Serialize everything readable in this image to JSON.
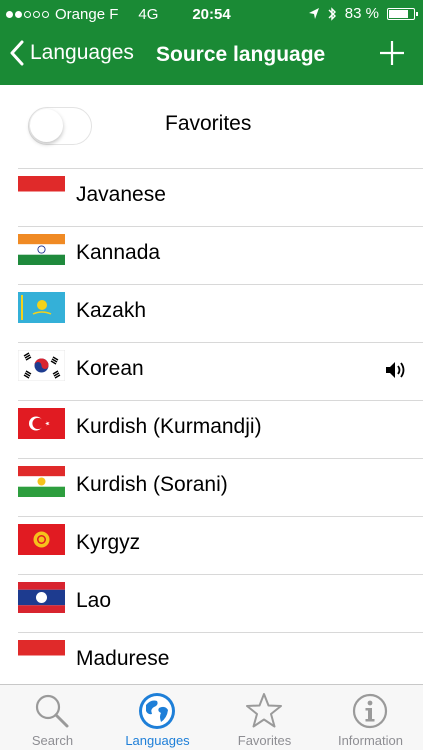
{
  "status_bar": {
    "carrier": "Orange F",
    "network": "4G",
    "time": "20:54",
    "battery": "83 %",
    "battery_level": 0.83
  },
  "nav": {
    "back_label": "Languages",
    "title": "Source language",
    "add_icon": "plus-icon"
  },
  "favorites_toggle": {
    "label": "Favorites",
    "on": false
  },
  "languages": [
    {
      "name": "Javanese",
      "flag": "indonesia"
    },
    {
      "name": "Kannada",
      "flag": "india"
    },
    {
      "name": "Kazakh",
      "flag": "kazakhstan"
    },
    {
      "name": "Korean",
      "flag": "south-korea",
      "speaker": true
    },
    {
      "name": "Kurdish (Kurmandji)",
      "flag": "turkey"
    },
    {
      "name": "Kurdish (Sorani)",
      "flag": "kurdistan"
    },
    {
      "name": "Kyrgyz",
      "flag": "kyrgyzstan"
    },
    {
      "name": "Lao",
      "flag": "laos"
    },
    {
      "name": "Madurese",
      "flag": "indonesia"
    }
  ],
  "tabs": [
    {
      "label": "Search",
      "icon": "search-icon",
      "active": false
    },
    {
      "label": "Languages",
      "icon": "globe-icon",
      "active": true
    },
    {
      "label": "Favorites",
      "icon": "star-icon",
      "active": false
    },
    {
      "label": "Information",
      "icon": "info-icon",
      "active": false
    }
  ],
  "colors": {
    "nav_green": "#1a8a35",
    "tab_active": "#1e7fd8",
    "tab_inactive": "#8e8e93"
  }
}
